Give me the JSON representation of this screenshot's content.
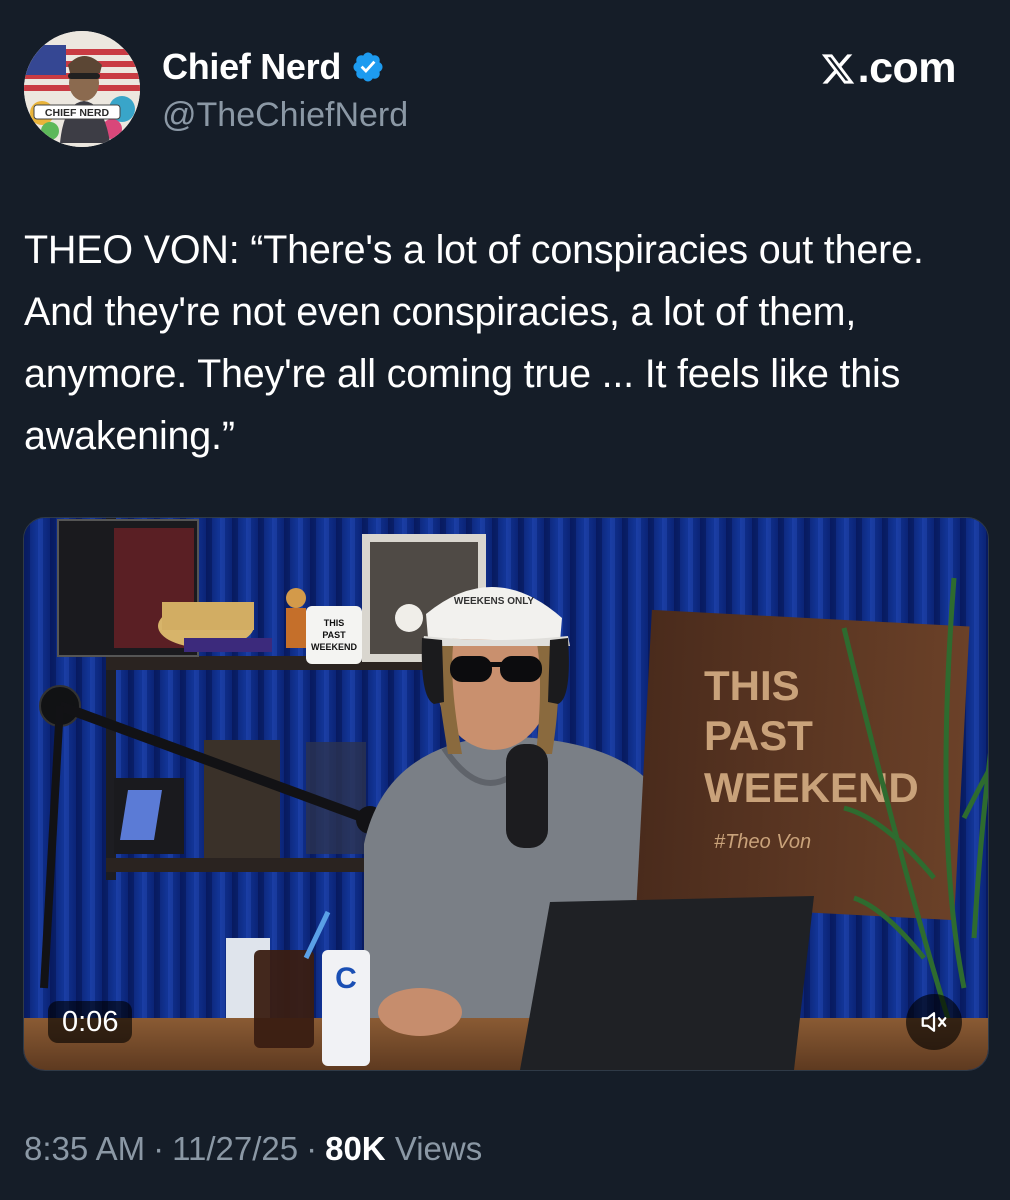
{
  "author": {
    "display_name": "Chief Nerd",
    "handle": "@TheChiefNerd",
    "verified": true,
    "avatar_badge_text": "CHIEF NERD"
  },
  "source": {
    "label": ".com",
    "logo_icon": "x-logo-icon"
  },
  "tweet": {
    "text": "THEO VON: “There's a lot of conspiracies out there. And they're not even conspiracies, a lot of them, anymore. They're all coming true ... It feels like this awakening.”"
  },
  "video": {
    "elapsed": "0:06",
    "muted": true,
    "mute_icon": "speaker-muted-icon",
    "sign_text": [
      "THIS",
      "PAST",
      "WEEKEND"
    ],
    "sign_signature": "#Theo Von",
    "mug_text": [
      "THIS",
      "PAST",
      "WEEKEND"
    ],
    "cap_text": "WEEKENS ONLY"
  },
  "meta": {
    "time": "8:35 AM",
    "date": "11/27/25",
    "views_count": "80K",
    "views_label": "Views"
  },
  "colors": {
    "background": "#151d28",
    "muted_text": "#8b98a5",
    "verified_blue": "#1d9bf0",
    "curtain_blue": "#0e2a8c"
  }
}
